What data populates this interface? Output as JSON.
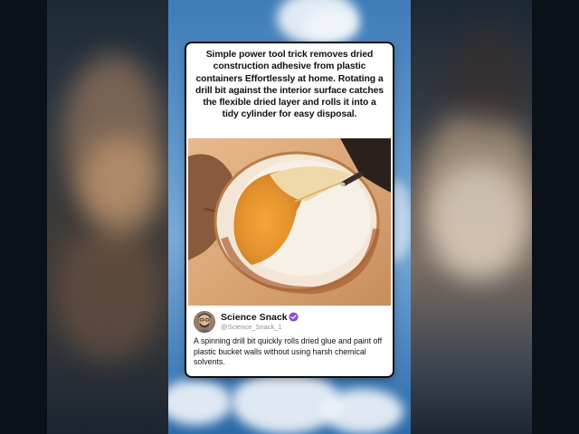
{
  "post": {
    "caption": "Simple power tool trick removes dried construction adhesive from plastic containers Effortlessly at home. Rotating a drill bit against the interior surface catches the flexible dried layer and rolls it into a tidy cylinder for easy disposal.",
    "photo_icon": "bucket-drill-photo",
    "author": {
      "name": "Science Snack",
      "handle": "@Science_Snack_1",
      "verified_icon": "verified-badge-icon",
      "avatar_icon": "avatar-portrait"
    },
    "text": "A spinning drill bit quickly rolls dried glue and paint off plastic bucket walls without using harsh chemical solvents."
  },
  "colors": {
    "verified": "#8a4dd6",
    "card": "#ffffff",
    "sky": "#5b93c9"
  }
}
